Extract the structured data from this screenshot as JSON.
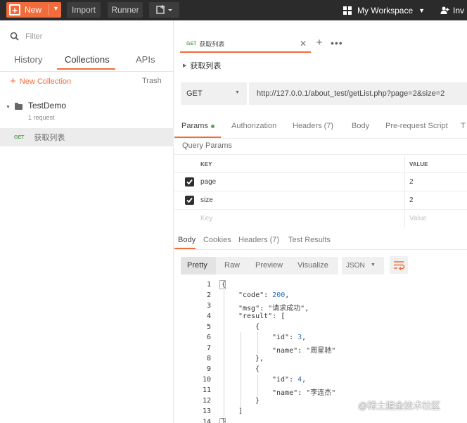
{
  "topbar": {
    "new_label": "New",
    "import_label": "Import",
    "runner_label": "Runner",
    "workspace_label": "My Workspace",
    "invite_label": "Inv"
  },
  "sidebar": {
    "filter_placeholder": "Filter",
    "tabs": [
      {
        "label": "History"
      },
      {
        "label": "Collections"
      },
      {
        "label": "APIs"
      }
    ],
    "new_collection_label": "New Collection",
    "trash_label": "Trash",
    "collection": {
      "name": "TestDemo",
      "count": "1 request"
    },
    "request": {
      "method": "GET",
      "name": "获取列表"
    }
  },
  "main": {
    "tab": {
      "method": "GET",
      "name": "获取列表"
    },
    "breadcrumb": "获取列表",
    "method": "GET",
    "url": "http://127.0.0.1/about_test/getList.php?page=2&size=2",
    "request_tabs": [
      {
        "label": "Params"
      },
      {
        "label": "Authorization"
      },
      {
        "label": "Headers (7)"
      },
      {
        "label": "Body"
      },
      {
        "label": "Pre-request Script"
      },
      {
        "label": "T"
      }
    ],
    "query_params_title": "Query Params",
    "table_head": {
      "key": "KEY",
      "value": "VALUE"
    },
    "params": [
      {
        "key": "page",
        "value": "2"
      },
      {
        "key": "size",
        "value": "2"
      }
    ],
    "placeholder_row": {
      "key": "Key",
      "value": "Value"
    },
    "response_tabs": [
      {
        "label": "Body"
      },
      {
        "label": "Cookies"
      },
      {
        "label": "Headers (7)"
      },
      {
        "label": "Test Results"
      }
    ],
    "formats": [
      {
        "label": "Pretty"
      },
      {
        "label": "Raw"
      },
      {
        "label": "Preview"
      },
      {
        "label": "Visualize"
      }
    ],
    "json_label": "JSON",
    "code_lines": [
      {
        "n": "1"
      },
      {
        "n": "2"
      },
      {
        "n": "3"
      },
      {
        "n": "4"
      },
      {
        "n": "5"
      },
      {
        "n": "6"
      },
      {
        "n": "7"
      },
      {
        "n": "8"
      },
      {
        "n": "9"
      },
      {
        "n": "10"
      },
      {
        "n": "11"
      },
      {
        "n": "12"
      },
      {
        "n": "13"
      },
      {
        "n": "14"
      }
    ],
    "json": {
      "code_key": "\"code\"",
      "code_val": "200",
      "msg_key": "\"msg\"",
      "msg_val": "\"请求成功\"",
      "result_key": "\"result\"",
      "id_key": "\"id\"",
      "id1": "3",
      "name_key": "\"name\"",
      "name1": "\"周星驰\"",
      "id2": "4",
      "name2": "\"李连杰\""
    }
  },
  "watermark": "@稀土掘金技术社区",
  "colors": {
    "accent": "#f26b3a",
    "topbar": "#2b2b2b",
    "get_method": "#5aa35f"
  }
}
